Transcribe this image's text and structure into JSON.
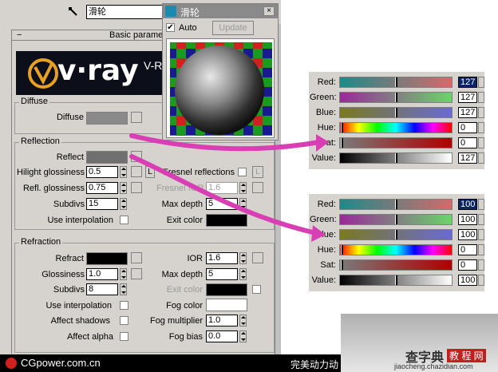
{
  "main_panel": {
    "name_field": "滑轮",
    "rollout_title": "Basic parameters",
    "rollout_collapse": "−",
    "logo_text": "v·ray",
    "logo_partial": "V-R"
  },
  "diffuse": {
    "group": "Diffuse",
    "label": "Diffuse",
    "color": "#8a8a8a"
  },
  "reflection": {
    "group": "Reflection",
    "reflect_label": "Reflect",
    "reflect_color": "#707070",
    "hilight_label": "Hilight glossiness",
    "hilight_value": "0.5",
    "lock_label": "L",
    "fresnel_label": "Fresnel reflections",
    "fresnel_lock": "L",
    "refl_gloss_label": "Refl. glossiness",
    "refl_gloss_value": "0.75",
    "fresnel_ior_label": "Fresnel IOR",
    "fresnel_ior_value": "1.6",
    "subdivs_label": "Subdivs",
    "subdivs_value": "15",
    "max_depth_label": "Max depth",
    "max_depth_value": "5",
    "use_interp_label": "Use interpolation",
    "exit_color_label": "Exit color",
    "exit_color": "#000000"
  },
  "refraction": {
    "group": "Refraction",
    "refract_label": "Refract",
    "refract_color": "#000000",
    "ior_label": "IOR",
    "ior_value": "1.6",
    "gloss_label": "Glossiness",
    "gloss_value": "1.0",
    "max_depth_label": "Max depth",
    "max_depth_value": "5",
    "subdivs_label": "Subdivs",
    "subdivs_value": "8",
    "exit_color_label": "Exit color",
    "exit_color": "#000000",
    "use_interp_label": "Use interpolation",
    "fog_color_label": "Fog color",
    "fog_color": "#ffffff",
    "affect_shadows_label": "Affect shadows",
    "fog_mult_label": "Fog multiplier",
    "fog_mult_value": "1.0",
    "affect_alpha_label": "Affect alpha",
    "fog_bias_label": "Fog bias",
    "fog_bias_value": "0.0"
  },
  "preview": {
    "title": "滑轮",
    "auto_label": "Auto",
    "auto_checked": "✔",
    "update_label": "Update"
  },
  "picker_top": {
    "rows": [
      {
        "label": "Red:",
        "value": "127",
        "sel": true
      },
      {
        "label": "Green:",
        "value": "127"
      },
      {
        "label": "Blue:",
        "value": "127"
      },
      {
        "label": "Hue:",
        "value": "0"
      },
      {
        "label": "Sat:",
        "value": "0"
      },
      {
        "label": "Value:",
        "value": "127"
      }
    ]
  },
  "picker_bottom": {
    "rows": [
      {
        "label": "Red:",
        "value": "100",
        "sel": true
      },
      {
        "label": "Green:",
        "value": "100"
      },
      {
        "label": "Blue:",
        "value": "100"
      },
      {
        "label": "Hue:",
        "value": "0"
      },
      {
        "label": "Sat:",
        "value": "0"
      },
      {
        "label": "Value:",
        "value": "100"
      }
    ]
  },
  "footer": {
    "cgpower": "CGpower.com.cn",
    "right_text": "完美动力动",
    "watermark_main": "查字典",
    "watermark_sub": "教 程 网",
    "watermark_url": "jiaocheng.chazidian.com"
  }
}
